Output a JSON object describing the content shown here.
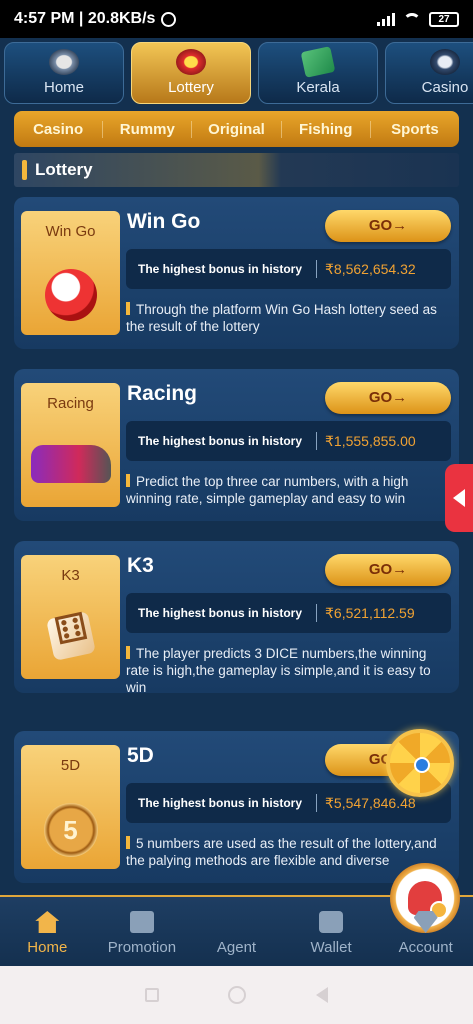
{
  "status": {
    "time_speed": "4:57 PM | 20.8KB/s",
    "battery": "27"
  },
  "top_tabs": [
    {
      "label": "Home",
      "icon": "home-icon"
    },
    {
      "label": "Lottery",
      "icon": "lottery-icon"
    },
    {
      "label": "Kerala",
      "icon": "kerala-icon"
    },
    {
      "label": "Casino",
      "icon": "casino-icon"
    }
  ],
  "sub_tabs": [
    "Casino",
    "Rummy",
    "Original",
    "Fishing",
    "Sports"
  ],
  "section": {
    "title": "Lottery"
  },
  "games": [
    {
      "thumb": "Win Go",
      "title": "Win Go",
      "go": "GO→",
      "bonus_label": "The highest bonus in history",
      "bonus_value": "₹8,562,654.32",
      "desc": "Through the platform Win Go Hash lottery seed as the result of the lottery"
    },
    {
      "thumb": "Racing",
      "title": "Racing",
      "go": "GO→",
      "bonus_label": "The highest bonus in history",
      "bonus_value": "₹1,555,855.00",
      "desc": "Predict the top three car numbers, with a high winning rate, simple gameplay and easy to win"
    },
    {
      "thumb": "K3",
      "title": "K3",
      "go": "GO→",
      "bonus_label": "The highest bonus in history",
      "bonus_value": "₹6,521,112.59",
      "desc": "The player predicts 3 DICE numbers,the winning rate is high,the gameplay is simple,and it is easy to win"
    },
    {
      "thumb": "5D",
      "title": "5D",
      "go": "GO→",
      "bonus_label": "The highest bonus in history",
      "bonus_value": "₹5,547,846.48",
      "desc": "5 numbers are used as the result of the lottery,and the palying methods are flexible and diverse",
      "art": "5"
    }
  ],
  "bottom_nav": [
    {
      "label": "Home",
      "icon": "home-icon"
    },
    {
      "label": "Promotion",
      "icon": "gift-icon"
    },
    {
      "label": "Agent",
      "icon": "agent-icon"
    },
    {
      "label": "Wallet",
      "icon": "wallet-icon"
    },
    {
      "label": "Account",
      "icon": "diamond-icon"
    }
  ],
  "colors": {
    "accent": "#f2b54a",
    "background": "#13304f",
    "bonus": "#f0a233"
  }
}
